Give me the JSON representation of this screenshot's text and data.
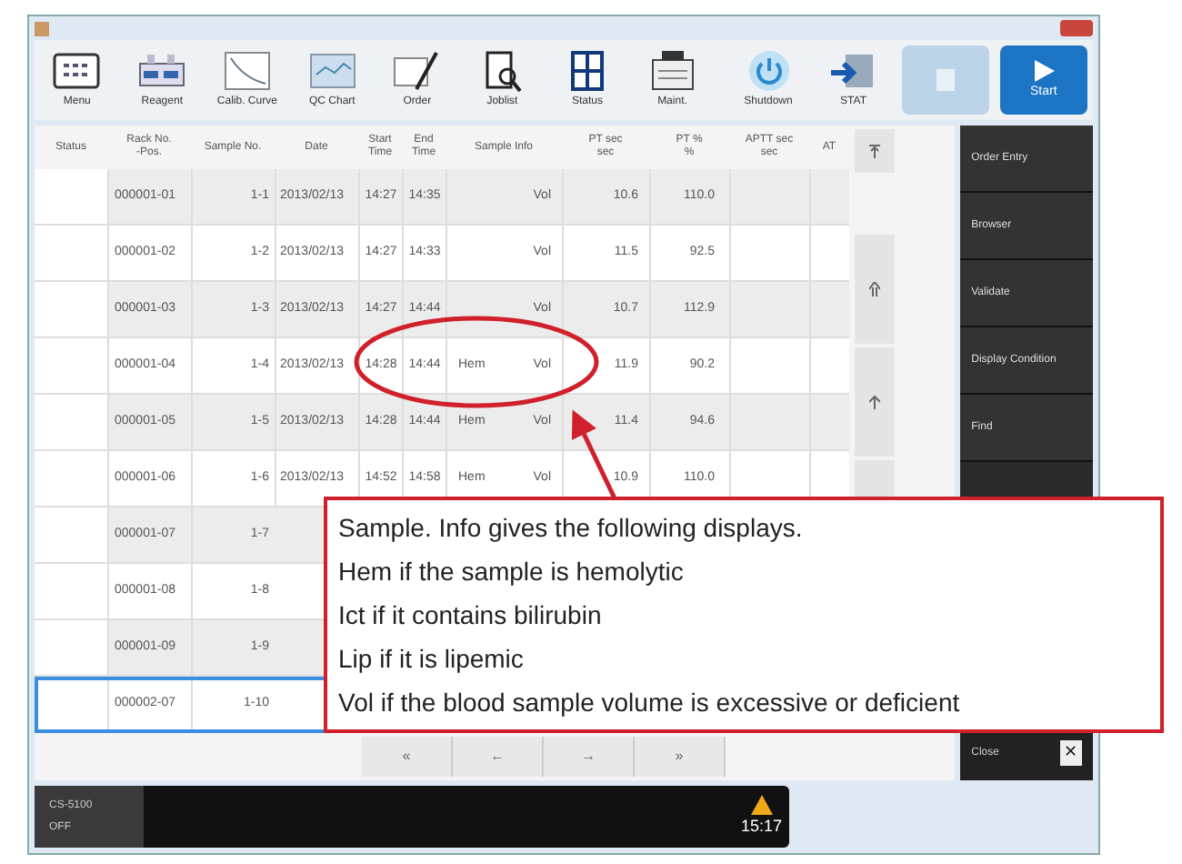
{
  "toolbar": [
    {
      "kind": "menu",
      "label": "Menu"
    },
    {
      "kind": "reagent",
      "label": "Reagent"
    },
    {
      "kind": "curve",
      "label": "Calib. Curve"
    },
    {
      "kind": "qc",
      "label": "QC Chart"
    },
    {
      "kind": "order",
      "label": "Order"
    },
    {
      "kind": "joblist",
      "label": "Joblist"
    },
    {
      "kind": "status",
      "label": "Status"
    },
    {
      "kind": "maint",
      "label": "Maint."
    }
  ],
  "toolbar_right": [
    {
      "kind": "shutdown",
      "label": "Shutdown"
    },
    {
      "kind": "stat",
      "label": "STAT"
    },
    {
      "kind": "stop"
    },
    {
      "kind": "start",
      "label": "Start"
    }
  ],
  "table": {
    "columns": [
      [
        "Status"
      ],
      [
        "Rack No.",
        "-Pos."
      ],
      [
        "Sample No."
      ],
      [
        "Date"
      ],
      [
        "Start",
        "Time"
      ],
      [
        "End",
        "Time"
      ],
      [
        "Sample Info"
      ],
      [
        "PT sec",
        "sec"
      ],
      [
        "PT %",
        "%"
      ],
      [
        "APTT sec",
        "sec"
      ],
      [
        "AT"
      ]
    ],
    "rows": [
      {
        "rack": "000001-01",
        "sample": "1-1",
        "date": "2013/02/13",
        "start": "14:27",
        "end": "14:35",
        "info_1": "",
        "info_2": "Vol",
        "pt_sec": "10.6",
        "pt_pct": "110.0",
        "selected": false
      },
      {
        "rack": "000001-02",
        "sample": "1-2",
        "date": "2013/02/13",
        "start": "14:27",
        "end": "14:33",
        "info_1": "",
        "info_2": "Vol",
        "pt_sec": "11.5",
        "pt_pct": "92.5",
        "selected": false
      },
      {
        "rack": "000001-03",
        "sample": "1-3",
        "date": "2013/02/13",
        "start": "14:27",
        "end": "14:44",
        "info_1": "",
        "info_2": "Vol",
        "pt_sec": "10.7",
        "pt_pct": "112.9",
        "selected": false
      },
      {
        "rack": "000001-04",
        "sample": "1-4",
        "date": "2013/02/13",
        "start": "14:28",
        "end": "14:44",
        "info_1": "Hem",
        "info_2": "Vol",
        "pt_sec": "11.9",
        "pt_pct": "90.2",
        "selected": false
      },
      {
        "rack": "000001-05",
        "sample": "1-5",
        "date": "2013/02/13",
        "start": "14:28",
        "end": "14:44",
        "info_1": "Hem",
        "info_2": "Vol",
        "pt_sec": "11.4",
        "pt_pct": "94.6",
        "selected": false
      },
      {
        "rack": "000001-06",
        "sample": "1-6",
        "date": "2013/02/13",
        "start": "14:52",
        "end": "14:58",
        "info_1": "Hem",
        "info_2": "Vol",
        "pt_sec": "10.9",
        "pt_pct": "110.0",
        "selected": false
      },
      {
        "rack": "000001-07",
        "sample": "1-7",
        "selected": false
      },
      {
        "rack": "000001-08",
        "sample": "1-8",
        "selected": false
      },
      {
        "rack": "000001-09",
        "sample": "1-9",
        "selected": false
      },
      {
        "rack": "000002-07",
        "sample": "1-10",
        "selected": true
      }
    ]
  },
  "page_nav": [
    "«",
    "←",
    "→",
    "»"
  ],
  "side_menu": [
    "Order Entry",
    "Browser",
    "Validate",
    "Display Condition",
    "Find"
  ],
  "close_button": {
    "label": "Close",
    "icon": "✕"
  },
  "status_bar": {
    "analyzer": "CS-5100",
    "state": "OFF",
    "time": "15:17"
  },
  "callout": [
    "Sample. Info gives the following displays.",
    "Hem if the sample is hemolytic",
    "Ict if it contains bilirubin",
    "Lip if it is lipemic",
    "Vol if the blood sample volume is excessive or deficient"
  ]
}
